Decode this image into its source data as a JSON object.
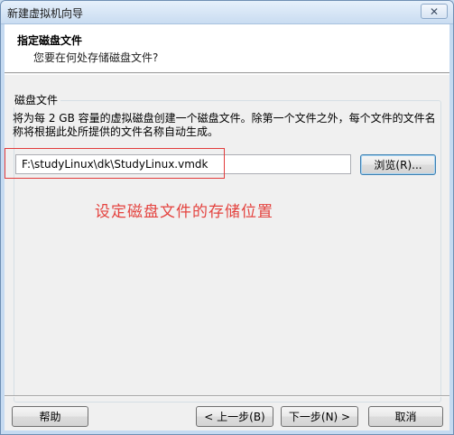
{
  "window": {
    "title": "新建虚拟机向导",
    "close_glyph": "✕"
  },
  "header": {
    "title": "指定磁盘文件",
    "subtitle": "您要在何处存储磁盘文件?"
  },
  "disk_group": {
    "label": "磁盘文件",
    "description": "将为每 2 GB 容量的虚拟磁盘创建一个磁盘文件。除第一个文件之外，每个文件的文件名称将根据此处所提供的文件名称自动生成。",
    "path_value": "F:\\studyLinux\\dk\\StudyLinux.vmdk",
    "browse_label": "浏览(R)..."
  },
  "annotation": {
    "text": "设定磁盘文件的存储位置",
    "color": "#e4433f"
  },
  "footer": {
    "help_label": "帮助",
    "back_label": "< 上一步(B)",
    "next_label": "下一步(N) >",
    "cancel_label": "取消"
  }
}
